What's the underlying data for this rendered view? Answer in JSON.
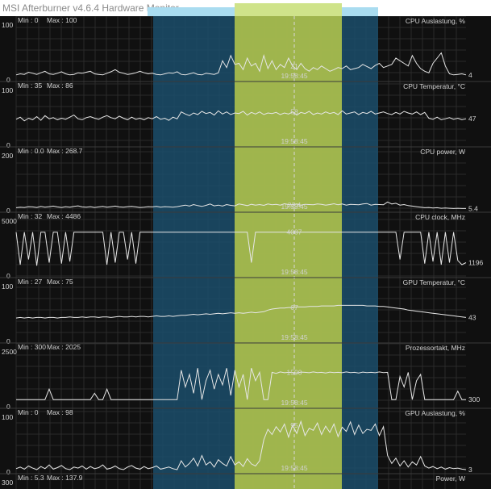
{
  "window": {
    "title": "MSI Afterburner v4.6.4 Hardware Monitor"
  },
  "colors": {
    "background": "#101010",
    "grid": "#2a2a2a",
    "trace": "#e6e6e6",
    "text": "#d2d2d2",
    "selection_blue": "#1b4d6b",
    "selection_green": "#b7c94a",
    "cursor": "#d8d8d8"
  },
  "cursor": {
    "time": "19:58:45"
  },
  "graphs": [
    {
      "name": "CPU Auslastung, %",
      "min_label": "Min : 0",
      "max_label": "Max : 100",
      "scale_top": "100",
      "scale_bottom": "0",
      "current_value": "4",
      "cursor_value": "21",
      "scale_max": 100,
      "trace": [
        8,
        10,
        9,
        13,
        11,
        9,
        12,
        15,
        10,
        9,
        11,
        14,
        10,
        8,
        9,
        12,
        11,
        13,
        15,
        10,
        9,
        8,
        11,
        14,
        18,
        13,
        11,
        9,
        10,
        12,
        15,
        12,
        10,
        11,
        9,
        8,
        10,
        12,
        11,
        14,
        9,
        8,
        10,
        12,
        9,
        8,
        11,
        10,
        9,
        12,
        35,
        22,
        45,
        28,
        30,
        18,
        40,
        25,
        30,
        15,
        45,
        20,
        35,
        18,
        28,
        22,
        40,
        25,
        18,
        30,
        20,
        15,
        22,
        18,
        25,
        20,
        15,
        18,
        22,
        20,
        25,
        18,
        20,
        22,
        28,
        24,
        20,
        26,
        30,
        22,
        25,
        28,
        40,
        35,
        30,
        25,
        45,
        30,
        20,
        15,
        12,
        30,
        40,
        50,
        25,
        10,
        8,
        9,
        10,
        8
      ]
    },
    {
      "name": "CPU Temperatur, °C",
      "min_label": "Min : 35",
      "max_label": "Max : 86",
      "scale_top": "100",
      "scale_bottom": "0",
      "current_value": "47",
      "cursor_value": "58",
      "scale_max": 100,
      "trace": [
        48,
        52,
        45,
        50,
        47,
        53,
        46,
        55,
        49,
        51,
        47,
        50,
        48,
        52,
        56,
        49,
        47,
        51,
        53,
        50,
        48,
        52,
        55,
        51,
        49,
        54,
        50,
        47,
        52,
        48,
        50,
        47,
        51,
        49,
        53,
        48,
        50,
        46,
        52,
        49,
        62,
        58,
        55,
        60,
        57,
        63,
        59,
        61,
        56,
        64,
        58,
        62,
        57,
        60,
        59,
        63,
        56,
        61,
        58,
        62,
        57,
        60,
        59,
        61,
        57,
        60,
        58,
        62,
        56,
        61,
        59,
        63,
        57,
        60,
        58,
        62,
        59,
        61,
        57,
        64,
        58,
        60,
        62,
        57,
        61,
        59,
        63,
        58,
        60,
        62,
        59,
        57,
        61,
        58,
        63,
        60,
        58,
        62,
        57,
        61,
        50,
        48,
        52,
        47,
        49,
        51,
        48,
        50,
        47,
        49
      ]
    },
    {
      "name": "CPU power, W",
      "min_label": "Min : 0.0",
      "max_label": "Max : 268.7",
      "scale_top": "200",
      "scale_bottom": "0",
      "current_value": "5.4",
      "cursor_value": "22.4",
      "scale_max": 200,
      "trace": [
        8,
        10,
        9,
        12,
        11,
        9,
        13,
        10,
        12,
        14,
        11,
        9,
        12,
        10,
        13,
        15,
        11,
        10,
        12,
        9,
        11,
        13,
        10,
        12,
        14,
        11,
        10,
        12,
        13,
        11,
        9,
        10,
        12,
        11,
        13,
        10,
        12,
        11,
        10,
        12,
        15,
        18,
        14,
        20,
        16,
        13,
        17,
        22,
        15,
        18,
        14,
        20,
        17,
        15,
        22,
        19,
        16,
        21,
        18,
        20,
        17,
        22,
        19,
        21,
        18,
        23,
        20,
        19,
        22,
        18,
        21,
        20,
        19,
        22,
        21,
        18,
        20,
        23,
        19,
        22,
        18,
        21,
        20,
        19,
        22,
        24,
        18,
        21,
        20,
        19,
        30,
        22,
        25,
        18,
        20,
        16,
        14,
        12,
        10,
        8,
        9,
        7,
        8,
        6,
        7,
        6,
        5,
        6,
        5,
        5
      ]
    },
    {
      "name": "CPU clock, MHz",
      "min_label": "Min : 32",
      "max_label": "Max : 4486",
      "scale_top": "5000",
      "scale_bottom": "0",
      "current_value": "1196",
      "cursor_value": "4087",
      "scale_max": 5000,
      "trace": [
        4100,
        1000,
        4100,
        1500,
        4100,
        900,
        4100,
        4100,
        1200,
        4100,
        4100,
        1100,
        4100,
        1300,
        4100,
        4100,
        4100,
        4100,
        4100,
        4100,
        4100,
        4100,
        1000,
        4100,
        1200,
        4100,
        4100,
        1500,
        4100,
        1100,
        4100,
        4100,
        4100,
        4100,
        4100,
        4100,
        4100,
        4100,
        4100,
        4100,
        4100,
        4100,
        4100,
        4100,
        4100,
        4100,
        4100,
        4100,
        4100,
        4100,
        4100,
        4100,
        4100,
        4100,
        4100,
        4100,
        4100,
        1200,
        4100,
        4100,
        4100,
        4100,
        4100,
        4100,
        4100,
        4100,
        4100,
        4100,
        4100,
        4100,
        4100,
        4100,
        4100,
        4100,
        4100,
        4100,
        4100,
        4100,
        4100,
        4100,
        4100,
        4100,
        4100,
        4100,
        4100,
        4100,
        4100,
        4100,
        4100,
        4100,
        4100,
        4100,
        4100,
        1500,
        4100,
        4100,
        4100,
        4100,
        4100,
        1100,
        4100,
        1300,
        4100,
        1000,
        4100,
        1200,
        4100,
        1400,
        1000,
        1196
      ]
    },
    {
      "name": "GPU Temperatur, °C",
      "min_label": "Min : 27",
      "max_label": "Max : 75",
      "scale_top": "100",
      "scale_bottom": "0",
      "current_value": "43",
      "cursor_value": "67",
      "scale_max": 100,
      "trace": [
        43,
        44,
        43,
        44,
        43,
        44,
        44,
        43,
        44,
        44,
        43,
        44,
        44,
        45,
        44,
        44,
        45,
        44,
        45,
        45,
        44,
        45,
        45,
        44,
        45,
        46,
        45,
        45,
        46,
        45,
        46,
        46,
        45,
        46,
        47,
        46,
        46,
        47,
        46,
        47,
        48,
        48,
        49,
        50,
        49,
        50,
        51,
        50,
        51,
        52,
        51,
        52,
        53,
        52,
        53,
        52,
        53,
        54,
        53,
        54,
        55,
        58,
        60,
        61,
        62,
        62,
        63,
        63,
        64,
        64,
        64,
        65,
        65,
        65,
        66,
        66,
        66,
        66,
        67,
        67,
        67,
        67,
        67,
        67,
        67,
        66,
        66,
        66,
        65,
        65,
        64,
        63,
        62,
        61,
        60,
        58,
        57,
        56,
        55,
        54,
        53,
        52,
        51,
        50,
        49,
        48,
        47,
        46,
        45,
        44
      ]
    },
    {
      "name": "Prozessortakt, MHz",
      "min_label": "Min : 300",
      "max_label": "Max : 2025",
      "scale_top": "2500",
      "scale_bottom": "0",
      "current_value": "300",
      "cursor_value": "1590",
      "scale_max": 2500,
      "trace": [
        300,
        300,
        300,
        300,
        300,
        300,
        300,
        300,
        800,
        300,
        300,
        300,
        300,
        300,
        300,
        300,
        300,
        300,
        300,
        600,
        300,
        300,
        800,
        300,
        300,
        300,
        300,
        300,
        300,
        300,
        300,
        300,
        300,
        300,
        300,
        300,
        300,
        300,
        300,
        300,
        1700,
        900,
        1500,
        600,
        1800,
        300,
        1200,
        1700,
        800,
        1500,
        1000,
        1800,
        500,
        1700,
        900,
        1500,
        300,
        1800,
        1200,
        1600,
        300,
        300,
        1600,
        1550,
        1620,
        1580,
        1600,
        1590,
        1570,
        1610,
        1600,
        1580,
        1620,
        1590,
        1600,
        1570,
        1610,
        1590,
        1600,
        1580,
        1620,
        1590,
        1600,
        1570,
        1610,
        1590,
        1600,
        1580,
        1620,
        1590,
        1600,
        300,
        300,
        1400,
        900,
        1600,
        300,
        1200,
        1500,
        300,
        300,
        300,
        300,
        300,
        300,
        300,
        300,
        700,
        300,
        300
      ]
    },
    {
      "name": "GPU Auslastung, %",
      "min_label": "Min : 0",
      "max_label": "Max : 98",
      "scale_top": "100",
      "scale_bottom": "0",
      "current_value": "3",
      "cursor_value": "95",
      "scale_max": 100,
      "trace": [
        5,
        8,
        4,
        10,
        6,
        3,
        9,
        5,
        12,
        4,
        7,
        11,
        5,
        3,
        8,
        6,
        10,
        4,
        9,
        5,
        7,
        12,
        4,
        6,
        10,
        5,
        3,
        8,
        11,
        6,
        4,
        9,
        5,
        7,
        10,
        4,
        6,
        8,
        5,
        3,
        20,
        8,
        15,
        25,
        10,
        30,
        12,
        18,
        8,
        22,
        15,
        10,
        28,
        12,
        18,
        9,
        24,
        14,
        10,
        20,
        60,
        80,
        70,
        85,
        75,
        90,
        65,
        88,
        72,
        95,
        68,
        82,
        78,
        92,
        70,
        86,
        74,
        90,
        66,
        84,
        76,
        94,
        70,
        88,
        72,
        80,
        78,
        90,
        68,
        85,
        30,
        15,
        25,
        10,
        20,
        8,
        18,
        12,
        28,
        10,
        6,
        9,
        5,
        8,
        4,
        7,
        5,
        6,
        4,
        3
      ]
    },
    {
      "name": "Power, W",
      "min_label": "Min : 5.3",
      "max_label": "Max : 137.9",
      "scale_top": "300",
      "scale_bottom": "",
      "current_value": "",
      "cursor_value": "",
      "scale_max": 300,
      "trace": []
    }
  ]
}
